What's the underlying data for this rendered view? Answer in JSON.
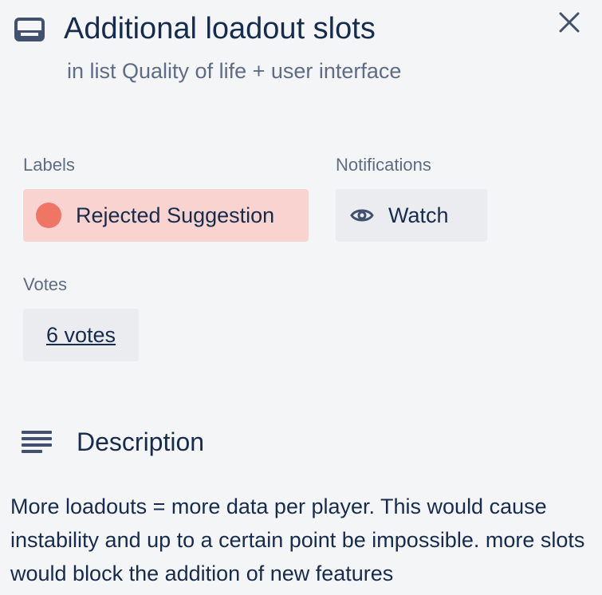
{
  "card": {
    "title": "Additional loadout slots",
    "list_line": "in list Quality of life + user interface"
  },
  "labels": {
    "heading": "Labels",
    "items": [
      {
        "text": "Rejected Suggestion",
        "color": "#ef7564",
        "chip_color": "#f8d3cf"
      }
    ]
  },
  "notifications": {
    "heading": "Notifications",
    "watch_label": "Watch"
  },
  "votes": {
    "heading": "Votes",
    "count_label": "6 votes"
  },
  "description": {
    "heading": "Description",
    "body": "More loadouts = more data per player. This would cause instability and up to a certain point be impossible. more slots would block the addition of new features"
  },
  "icons": {
    "card": "card-icon",
    "close": "close-icon",
    "watch": "eye-icon",
    "description": "description-lines-icon"
  }
}
